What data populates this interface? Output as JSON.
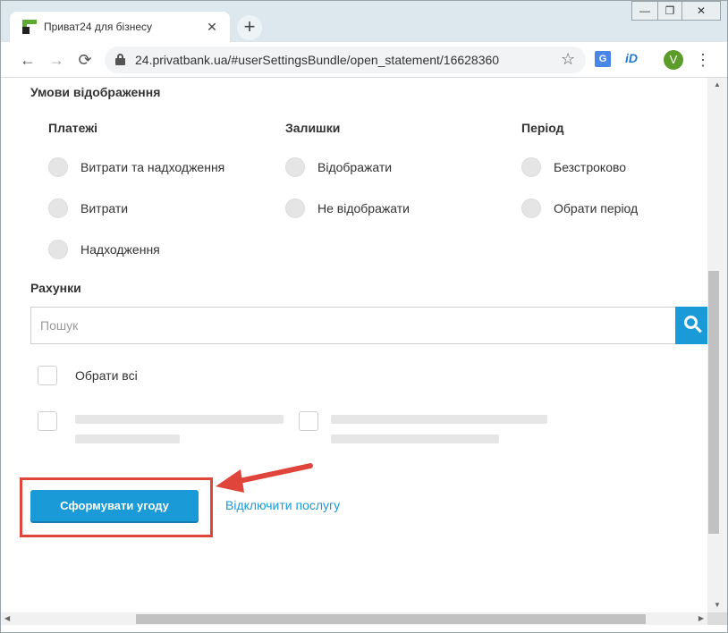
{
  "browser": {
    "tab_title": "Приват24 для бізнесу",
    "tab_close": "✕",
    "new_tab": "+",
    "window_min": "—",
    "window_max": "❐",
    "window_close": "✕",
    "back": "←",
    "forward": "→",
    "reload": "⟳",
    "url": "24.privatbank.ua/#userSettingsBundle/open_statement/16628360",
    "bookmark_star": "☆",
    "translate_ext": "G",
    "id_ext": "iD",
    "avatar_letter": "V",
    "menu": "⋮"
  },
  "display_conditions": {
    "title": "Умови відображення",
    "columns": [
      {
        "title": "Платежі",
        "options": [
          "Витрати та надходження",
          "Витрати",
          "Надходження"
        ]
      },
      {
        "title": "Залишки",
        "options": [
          "Відображати",
          "Не відображати"
        ]
      },
      {
        "title": "Період",
        "options": [
          "Безстроково",
          "Обрати період"
        ]
      }
    ]
  },
  "accounts": {
    "title": "Рахунки",
    "search_placeholder": "Пошук",
    "select_all_label": "Обрати всі"
  },
  "actions": {
    "primary_button": "Сформувати угоду",
    "disable_link": "Відключити послугу"
  },
  "scroll": {
    "up": "▲",
    "down": "▼",
    "left": "◀",
    "right": "▶"
  },
  "colors": {
    "accent": "#1a9ad6",
    "highlight": "#e0453b",
    "brand_green": "#5daa31"
  }
}
